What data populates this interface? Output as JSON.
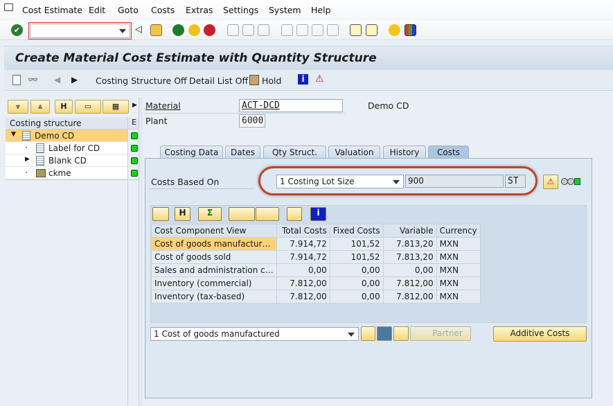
{
  "menu": {
    "items": [
      "Cost Estimate",
      "Edit",
      "Goto",
      "Costs",
      "Extras",
      "Settings",
      "System",
      "Help"
    ]
  },
  "toolbar": {
    "command_value": ""
  },
  "title": "Create Material Cost Estimate with Quantity Structure",
  "app_toolbar": {
    "costing_structure_off": "Costing Structure Off",
    "detail_list_off": "Detail List Off",
    "hold": "Hold"
  },
  "tree": {
    "header": "Costing structure",
    "col2_header": "E",
    "items": [
      {
        "label": "Demo CD",
        "status": "green"
      },
      {
        "label": "Label for CD",
        "status": "green"
      },
      {
        "label": "Blank CD",
        "status": "green"
      },
      {
        "label": "ckme",
        "status": "green"
      }
    ]
  },
  "header_fields": {
    "material_label": "Material",
    "material_value": "ACT-DCD",
    "material_desc": "Demo CD",
    "plant_label": "Plant",
    "plant_value": "6000"
  },
  "tabs": [
    "Costing Data",
    "Dates",
    "Qty Struct.",
    "Valuation",
    "History",
    "Costs"
  ],
  "active_tab": "Costs",
  "costs": {
    "based_on_label": "Costs Based On",
    "based_on_value": "1 Costing Lot Size",
    "quantity": "900",
    "unit": "ST"
  },
  "grid": {
    "columns": [
      "Cost Component View",
      "Total Costs",
      "Fixed Costs",
      "Variable",
      "Currency"
    ],
    "rows": [
      [
        "Cost of goods manufactur…",
        "7.914,72",
        "101,52",
        "7.813,20",
        "MXN"
      ],
      [
        "Cost of goods sold",
        "7.914,72",
        "101,52",
        "7.813,20",
        "MXN"
      ],
      [
        "Sales and administration c…",
        "0,00",
        "0,00",
        "0,00",
        "MXN"
      ],
      [
        "Inventory (commercial)",
        "7.812,00",
        "0,00",
        "7.812,00",
        "MXN"
      ],
      [
        "Inventory (tax-based)",
        "7.812,00",
        "0,00",
        "7.812,00",
        "MXN"
      ]
    ]
  },
  "bottom": {
    "view_value": "1 Cost of goods manufactured",
    "partner": "Partner",
    "additive_costs": "Additive Costs"
  },
  "colors": {
    "highlight": "#fcd27b",
    "status_green": "#19d11a",
    "oval": "#c0452b"
  }
}
